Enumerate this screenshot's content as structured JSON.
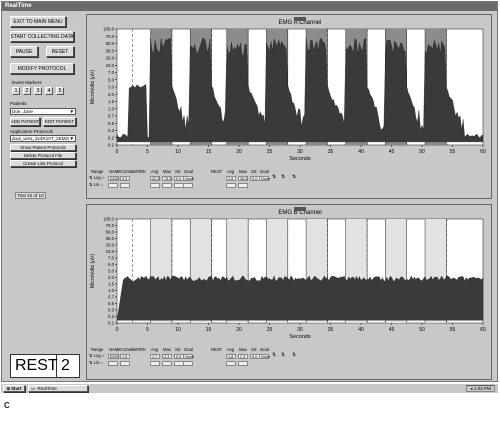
{
  "window": {
    "title": "RealTime"
  },
  "controls": {
    "exit_label": "EXIT TO MAIN MENU",
    "start_label": "START COLLECTING DATA",
    "pause_label": "PAUSE",
    "reset_label": "RESET",
    "modify_label": "MODIFY PROTOCOL",
    "event_markers_label": "Event Markers",
    "markers": [
      "1",
      "2",
      "3",
      "4",
      "5"
    ],
    "patients_label": "Patients",
    "patient_value": "Doe, Jane",
    "add_patient_label": "ADD PATIENT",
    "edit_patient_label": "EDIT PATIENT",
    "app_protocols_label": "Application Protocols",
    "protocol_value": "dual_wins_3x4R10T_2EMGs",
    "show_protocols_label": "Show Patient Protocols",
    "delete_protocol_label": "Delete Protocol File",
    "create_link_label": "Create Link Protocol",
    "trial_label": "Trial 10 of 10",
    "state_label": "REST",
    "state_count": "2"
  },
  "chart_a": {
    "title": "EMG  A  Channel",
    "ylabel": "MicroVolts (µV)",
    "xlabel": "Seconds",
    "yticks": [
      "100.0",
      "70.0",
      "50.0",
      "30.0",
      "20.0",
      "10.0",
      "7.0",
      "5.0",
      "3.0",
      "2.0",
      "1.5",
      "1.0",
      "0.7",
      "0.5",
      "0.3",
      "0.2",
      "0.1"
    ],
    "xticks": [
      "0",
      "5",
      "10",
      "15",
      "20",
      "25",
      "30",
      "35",
      "40",
      "45",
      "50",
      "55",
      "60"
    ]
  },
  "chart_b": {
    "title": "EMG  B  Channel",
    "ylabel": "MicroVolts (µV)",
    "xlabel": "Seconds",
    "yticks": [
      "100.0",
      "70.0",
      "50.0",
      "30.0",
      "20.0",
      "10.0",
      "7.0",
      "5.0",
      "3.0",
      "2.0",
      "1.5",
      "1.0",
      "0.7",
      "0.5",
      "0.3",
      "0.2",
      "0.1"
    ],
    "xticks": [
      "0",
      "5",
      "10",
      "15",
      "20",
      "25",
      "30",
      "35",
      "40",
      "45",
      "50",
      "55",
      "60"
    ]
  },
  "table_a": {
    "headers": [
      "Range",
      "NAME",
      "CutVal",
      "WORK",
      "Avg",
      "Max",
      "SS",
      "Goal",
      "REST",
      "Avg",
      "Max",
      "SS",
      "Goal"
    ],
    "log_label": "Log",
    "lin_label": "Lin",
    "row": [
      "EMG A",
      "0.5",
      "22.3",
      "75.5",
      "0.0",
      "None",
      "2.8",
      "26.0",
      "0.0",
      "None"
    ]
  },
  "table_b": {
    "headers": [
      "Range",
      "NAME",
      "CutVal",
      "WORK",
      "Avg",
      "Max",
      "SS",
      "Goal",
      "REST",
      "Avg",
      "Max",
      "SS",
      "Goal"
    ],
    "log_label": "Log",
    "lin_label": "Lin",
    "row": [
      "EMG B",
      "1.5",
      "1.7",
      "2.3",
      "0.0",
      "None",
      "1.8",
      "2.3",
      "0.0",
      "None"
    ]
  },
  "taskbar": {
    "start_label": "Start",
    "task_label": "RealTime",
    "time": "1:02 PM"
  },
  "caption": "C"
}
